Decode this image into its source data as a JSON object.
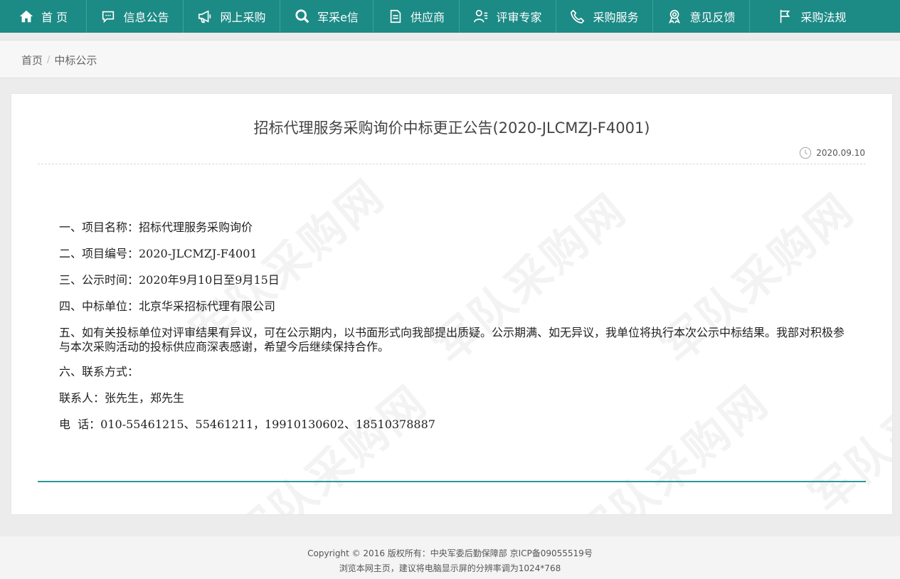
{
  "nav": {
    "items": [
      {
        "label": "首 页",
        "icon": "home-icon"
      },
      {
        "label": "信息公告",
        "icon": "chat-icon"
      },
      {
        "label": "网上采购",
        "icon": "megaphone-icon"
      },
      {
        "label": "军采e信",
        "icon": "search-icon"
      },
      {
        "label": "供应商",
        "icon": "document-icon"
      },
      {
        "label": "评审专家",
        "icon": "expert-icon"
      },
      {
        "label": "采购服务",
        "icon": "phone-icon"
      },
      {
        "label": "意见反馈",
        "icon": "award-icon"
      },
      {
        "label": "采购法规",
        "icon": "flag-icon"
      }
    ]
  },
  "breadcrumb": {
    "home": "首页",
    "separator": "/",
    "current": "中标公示"
  },
  "article": {
    "title": "招标代理服务采购询价中标更正公告(2020-JLCMZJ-F4001)",
    "date": "2020.09.10",
    "lines": [
      "一、项目名称：招标代理服务采购询价",
      "二、项目编号：2020-JLCMZJ-F4001",
      "三、公示时间：2020年9月10日至9月15日",
      "四、中标单位：北京华采招标代理有限公司",
      "五、如有关投标单位对评审结果有异议，可在公示期内，以书面形式向我部提出质疑。公示期满、如无异议，我单位将执行本次公示中标结果。我部对积极参与本次采购活动的投标供应商深表感谢，希望今后继续保持合作。",
      "六、联系方式：",
      "联系人：张先生，郑先生",
      "电  话：010-55461215、55461211，19910130602、18510378887"
    ],
    "watermark": "军队采购网"
  },
  "footer": {
    "line1": "Copyright © 2016 版权所有：中央军委后勤保障部 京ICP备09055519号",
    "line2": "浏览本网主页，建议将电脑显示屏的分辨率调为1024*768"
  },
  "colors": {
    "nav": "#1c8a85",
    "accent": "#2a9a94"
  }
}
